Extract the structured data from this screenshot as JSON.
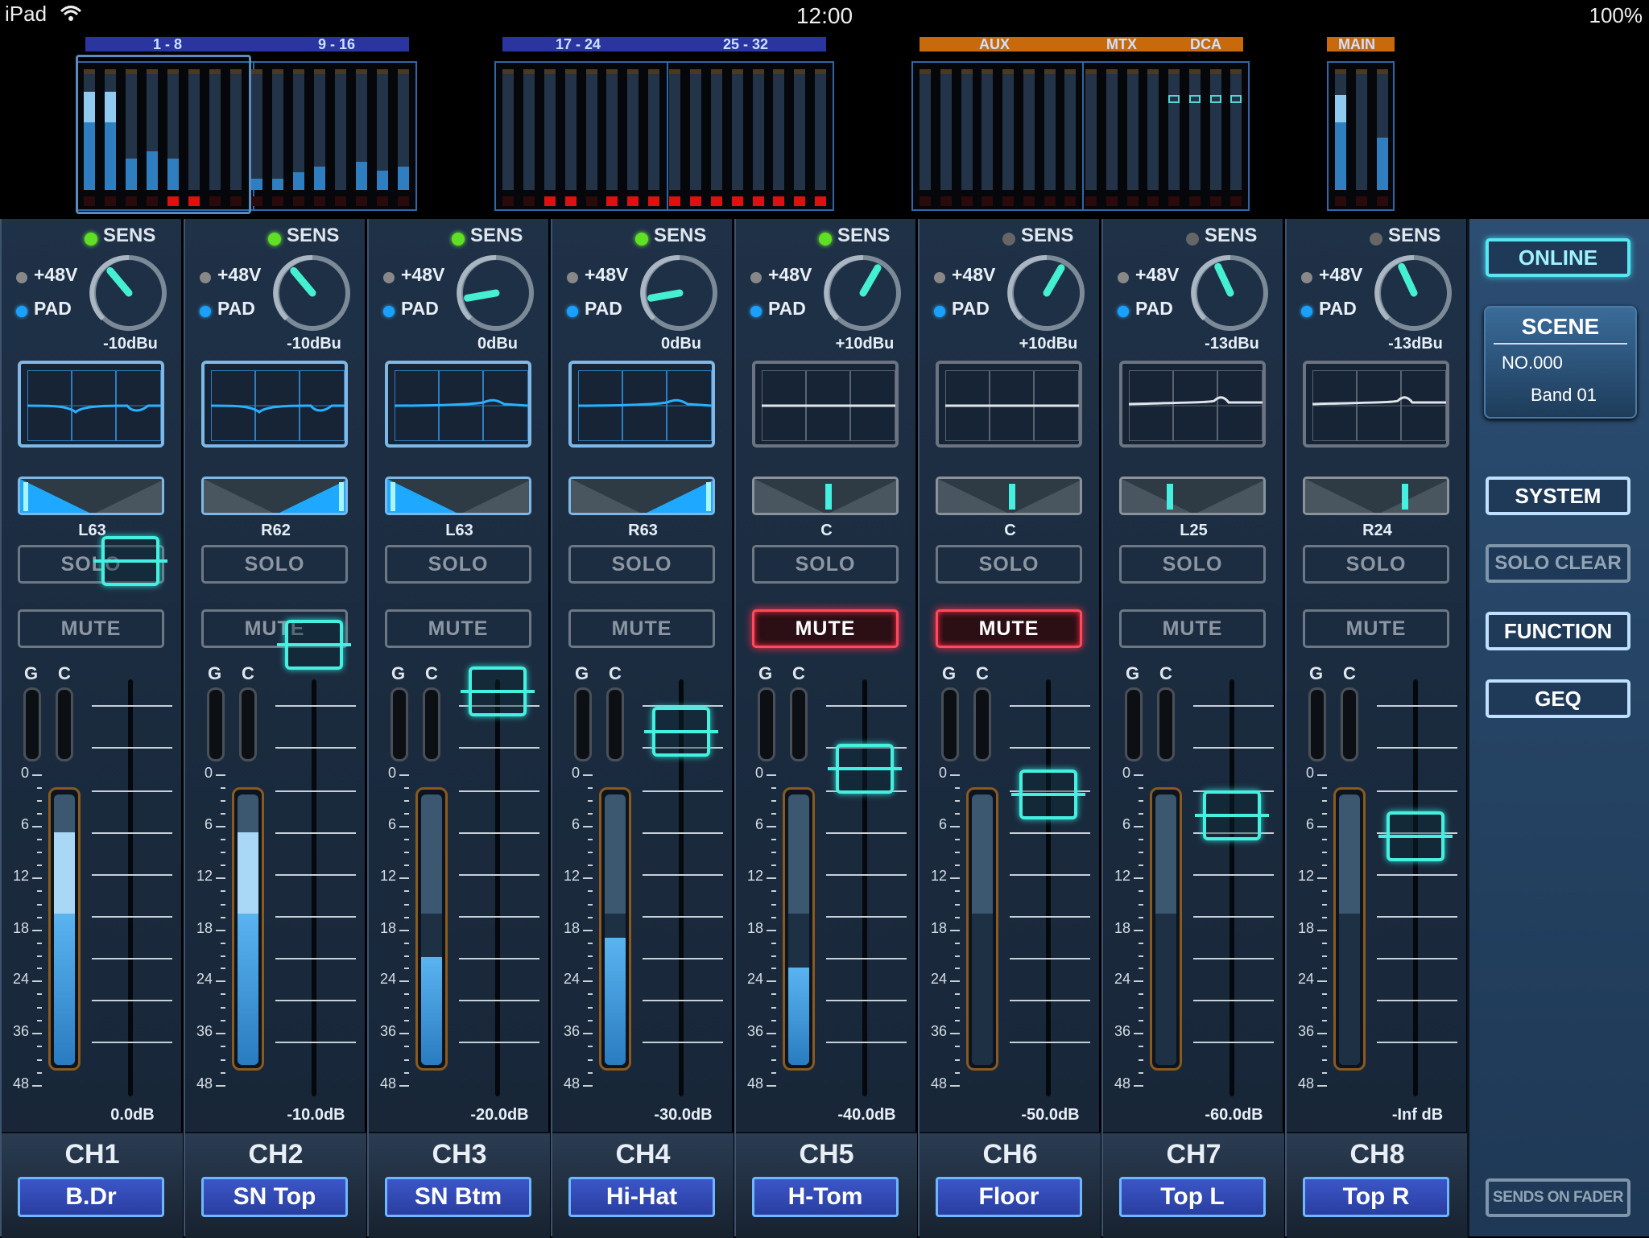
{
  "status": {
    "device": "iPad",
    "time": "12:00",
    "battery": "100%"
  },
  "overview": {
    "groups": [
      {
        "id": "g1",
        "labels": [
          "1 - 8",
          "9 - 16"
        ]
      },
      {
        "id": "g2",
        "labels": [
          "17 - 24",
          "25 - 32"
        ]
      },
      {
        "id": "g3",
        "labels": [
          "AUX",
          "MTX",
          "DCA"
        ]
      },
      {
        "id": "g4",
        "labels": [
          "MAIN"
        ]
      }
    ]
  },
  "colors": {
    "accent": "#45f0e0",
    "mute_on": "#ff4a5c",
    "sens_on": "#5fe024",
    "label_bg": "#3b56c8",
    "panel": "#1f3147"
  },
  "fader_scale": [
    "0",
    "6",
    "12",
    "18",
    "24",
    "36",
    "48"
  ],
  "gc_labels": [
    "G",
    "C"
  ],
  "channels": [
    {
      "name": "CH1",
      "label": "B.Dr",
      "sens": true,
      "gain": "-10dBu",
      "gain_angle": -40,
      "eq_on": true,
      "pan": "L63",
      "pan_pos": -1,
      "pan_on": true,
      "solo": "SOLO",
      "mute": "MUTE",
      "mute_on": false,
      "fader": "0.0dB",
      "fader_level": 0.0,
      "meter": 0.86,
      "meter_peak": 0.6
    },
    {
      "name": "CH2",
      "label": "SN Top",
      "sens": true,
      "gain": "-10dBu",
      "gain_angle": -40,
      "eq_on": true,
      "pan": "R62",
      "pan_pos": 1,
      "pan_on": true,
      "solo": "SOLO",
      "mute": "MUTE",
      "mute_on": false,
      "fader": "-10.0dB",
      "fader_level": -10,
      "meter": 0.86,
      "meter_peak": 0.58
    },
    {
      "name": "CH3",
      "label": "SN Btm",
      "sens": true,
      "gain": "0dBu",
      "gain_angle": -100,
      "eq_on": true,
      "pan": "L63",
      "pan_pos": -1,
      "pan_on": true,
      "solo": "SOLO",
      "mute": "MUTE",
      "mute_on": false,
      "fader": "-20.0dB",
      "fader_level": -20,
      "meter": 0.4,
      "meter_peak": 0
    },
    {
      "name": "CH4",
      "label": "Hi-Hat",
      "sens": true,
      "gain": "0dBu",
      "gain_angle": -100,
      "eq_on": true,
      "pan": "R63",
      "pan_pos": 1,
      "pan_on": true,
      "solo": "SOLO",
      "mute": "MUTE",
      "mute_on": false,
      "fader": "-30.0dB",
      "fader_level": -30,
      "meter": 0.47,
      "meter_peak": 0
    },
    {
      "name": "CH5",
      "label": "H-Tom",
      "sens": true,
      "gain": "+10dBu",
      "gain_angle": 30,
      "eq_on": false,
      "pan": "C",
      "pan_pos": 0,
      "pan_on": false,
      "solo": "SOLO",
      "mute": "MUTE",
      "mute_on": true,
      "fader": "-40.0dB",
      "fader_level": -40,
      "meter": 0.36,
      "meter_peak": 0
    },
    {
      "name": "CH6",
      "label": "Floor",
      "sens": false,
      "gain": "+10dBu",
      "gain_angle": 30,
      "eq_on": false,
      "pan": "C",
      "pan_pos": 0,
      "pan_on": false,
      "solo": "SOLO",
      "mute": "MUTE",
      "mute_on": true,
      "fader": "-50.0dB",
      "fader_level": -50,
      "meter": 0,
      "meter_peak": 0
    },
    {
      "name": "CH7",
      "label": "Top L",
      "sens": false,
      "gain": "-13dBu",
      "gain_angle": -25,
      "eq_on": false,
      "pan": "L25",
      "pan_pos": -0.4,
      "pan_on": false,
      "solo": "SOLO",
      "mute": "MUTE",
      "mute_on": false,
      "fader": "-60.0dB",
      "fader_level": -60,
      "meter": 0,
      "meter_peak": 0
    },
    {
      "name": "CH8",
      "label": "Top R",
      "sens": false,
      "gain": "-13dBu",
      "gain_angle": -25,
      "eq_on": false,
      "pan": "R24",
      "pan_pos": 0.4,
      "pan_on": false,
      "solo": "SOLO",
      "mute": "MUTE",
      "mute_on": false,
      "fader": "-Inf dB",
      "fader_level": -100,
      "meter": 0,
      "meter_peak": 0
    }
  ],
  "common": {
    "sens": "SENS",
    "phantom": "+48V",
    "pad": "PAD"
  },
  "right_panel": {
    "online": "ONLINE",
    "scene_title": "SCENE",
    "scene_no": "NO.000",
    "scene_name": "Band 01",
    "system": "SYSTEM",
    "solo_clear": "SOLO CLEAR",
    "function": "FUNCTION",
    "geq": "GEQ",
    "sends_on_fader": "SENDS ON FADER"
  }
}
